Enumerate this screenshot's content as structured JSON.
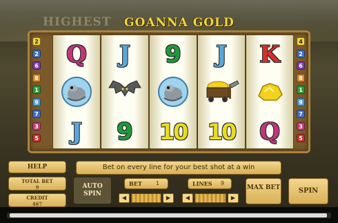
{
  "game": {
    "title": "GOANNA GOLD",
    "title_ghost": "HIGHEST",
    "message": "Bet on every line for your best shot at a win"
  },
  "reels": [
    [
      {
        "label": "Q",
        "color": "#c0367a",
        "kind": "letter"
      },
      {
        "label": "",
        "icon": "goanna-icon",
        "kind": "icon"
      },
      {
        "label": "J",
        "color": "#5aa7d8",
        "kind": "letter"
      }
    ],
    [
      {
        "label": "J",
        "color": "#5aa7d8",
        "kind": "letter"
      },
      {
        "label": "",
        "icon": "bat-icon",
        "kind": "icon"
      },
      {
        "label": "9",
        "color": "#1f9a3a",
        "kind": "num"
      }
    ],
    [
      {
        "label": "9",
        "color": "#1f9a3a",
        "kind": "num"
      },
      {
        "label": "",
        "icon": "goanna-icon",
        "kind": "icon"
      },
      {
        "label": "10",
        "color": "#e7dd23",
        "kind": "ten"
      }
    ],
    [
      {
        "label": "J",
        "color": "#5aa7d8",
        "kind": "letter"
      },
      {
        "label": "",
        "icon": "gold-cart-icon",
        "kind": "icon"
      },
      {
        "label": "10",
        "color": "#e7dd23",
        "kind": "ten"
      }
    ],
    [
      {
        "label": "K",
        "color": "#d4312b",
        "kind": "letter"
      },
      {
        "label": "",
        "icon": "gold-nugget-icon",
        "kind": "icon"
      },
      {
        "label": "Q",
        "color": "#c0367a",
        "kind": "letter"
      }
    ]
  ],
  "paylines_left": [
    {
      "n": "2",
      "color": "#f1d443"
    },
    {
      "n": "2",
      "color": "#3f6fc5"
    },
    {
      "n": "6",
      "color": "#7a3fa8"
    },
    {
      "n": "8",
      "color": "#e08a2b"
    },
    {
      "n": "1",
      "color": "#2e9b3b"
    },
    {
      "n": "9",
      "color": "#4b9bd1"
    },
    {
      "n": "7",
      "color": "#3d6fcf"
    },
    {
      "n": "3",
      "color": "#c43c7f"
    },
    {
      "n": "5",
      "color": "#c43131"
    }
  ],
  "paylines_right": [
    {
      "n": "4",
      "color": "#f1d443"
    },
    {
      "n": "2",
      "color": "#3f6fc5"
    },
    {
      "n": "6",
      "color": "#7a3fa8"
    },
    {
      "n": "8",
      "color": "#e08a2b"
    },
    {
      "n": "1",
      "color": "#2e9b3b"
    },
    {
      "n": "9",
      "color": "#4b9bd1"
    },
    {
      "n": "7",
      "color": "#3d6fcf"
    },
    {
      "n": "3",
      "color": "#c43c7f"
    },
    {
      "n": "5",
      "color": "#c43131"
    }
  ],
  "controls": {
    "help": "HELP",
    "total_bet_label": "TOTAL BET",
    "total_bet_value": "9",
    "credit_label": "CREDIT",
    "credit_value": "467",
    "auto_spin": "AUTO SPIN",
    "bet_label": "BET",
    "bet_value": "1",
    "lines_label": "LINES",
    "lines_value": "9",
    "max_bet": "MAX BET",
    "spin": "SPIN"
  }
}
